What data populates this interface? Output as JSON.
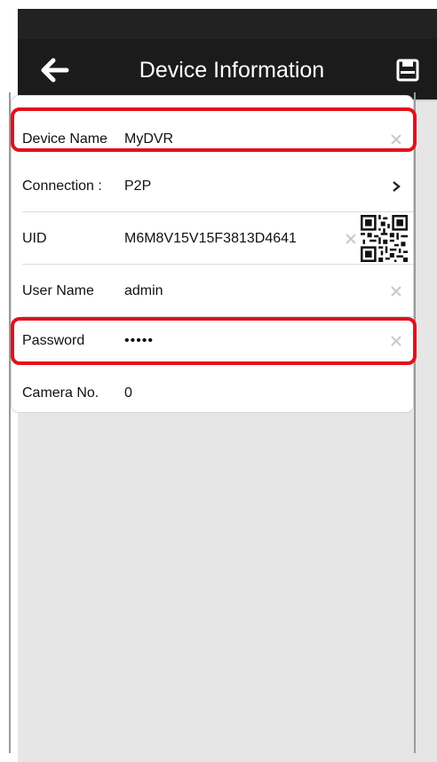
{
  "header": {
    "title": "Device Information",
    "back_icon": "arrow-left-icon",
    "save_icon": "floppy-disk-icon"
  },
  "form": {
    "fields": [
      {
        "label": "Device Name",
        "value": "MyDVR",
        "editable": true
      },
      {
        "label": "Connection",
        "separator": ":",
        "value": "P2P"
      },
      {
        "label": "UID",
        "value": "M6M8V15V15F3813D4641",
        "editable": true,
        "qr_icon": "qr-code-icon"
      },
      {
        "label": "User Name",
        "value": "admin",
        "editable": true
      },
      {
        "label": "Password",
        "value": "•••••",
        "editable": true
      },
      {
        "label": "Camera No.",
        "value": "0"
      }
    ]
  },
  "colors": {
    "nav_background": "#1b1b1b",
    "highlight": "#e3101c",
    "page_background": "#e6e6e6"
  }
}
